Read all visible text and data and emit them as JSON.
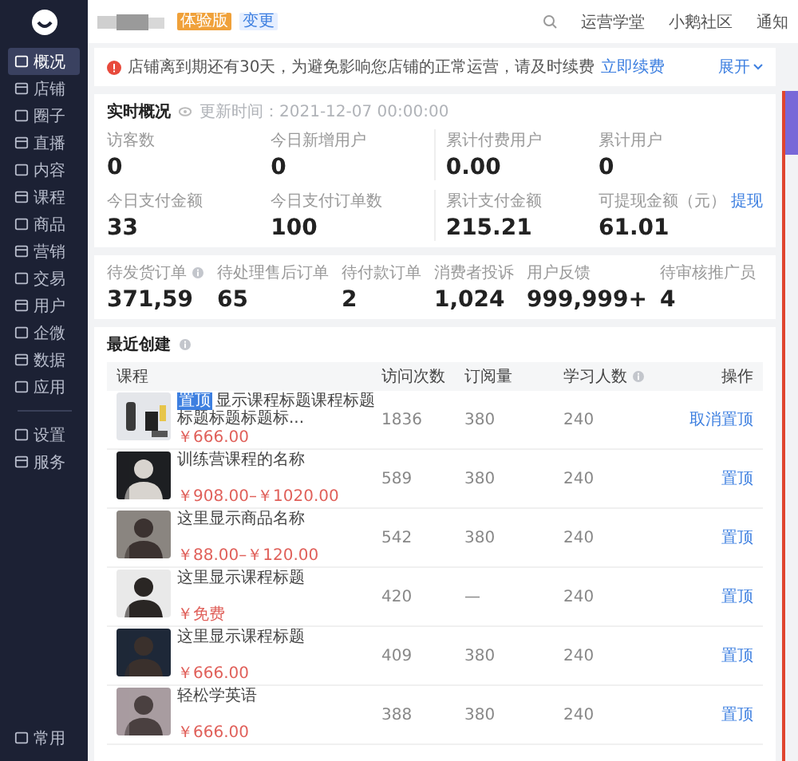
{
  "sidebar": {
    "items": [
      {
        "label": "概况",
        "selected": true
      },
      {
        "label": "店铺",
        "selected": false
      },
      {
        "label": "圈子",
        "selected": false
      },
      {
        "label": "直播",
        "selected": false
      },
      {
        "label": "内容",
        "selected": false
      },
      {
        "label": "课程",
        "selected": false
      },
      {
        "label": "商品",
        "selected": false
      },
      {
        "label": "营销",
        "selected": false
      },
      {
        "label": "交易",
        "selected": false
      },
      {
        "label": "用户",
        "selected": false
      },
      {
        "label": "企微",
        "selected": false
      },
      {
        "label": "数据",
        "selected": false
      },
      {
        "label": "应用",
        "selected": false
      }
    ],
    "settings_items": [
      {
        "label": "设置",
        "selected": false
      },
      {
        "label": "服务",
        "selected": false
      }
    ],
    "footer": "常用"
  },
  "header": {
    "badges": [
      {
        "text": "体验版",
        "kind": "edition"
      },
      {
        "text": "变更",
        "kind": "link"
      }
    ],
    "links": [
      "运营学堂",
      "小鹅社区",
      "通知"
    ]
  },
  "alert": {
    "message": "店铺离到期还有30天，为避免影响您店铺的正常运营，请及时续费",
    "action": "立即续费",
    "expand": "展开"
  },
  "realtime": {
    "title": "实时概况",
    "updated": "更新时间：2021-12-07 00:00:00",
    "metrics": [
      {
        "label": "访客数",
        "value": "0"
      },
      {
        "label": "今日新增用户",
        "value": "0"
      },
      {
        "label": "累计付费用户",
        "value": "0.00"
      },
      {
        "label": "累计用户",
        "value": "0"
      },
      {
        "label": "今日支付金额",
        "value": "33"
      },
      {
        "label": "今日支付订单数",
        "value": "100"
      },
      {
        "label": "累计支付金额",
        "value": "215.21"
      },
      {
        "label": "可提现金额（元）",
        "value": "61.01",
        "link": "提现"
      }
    ]
  },
  "todo": {
    "items": [
      {
        "label": "待发货订单",
        "value": "371,59",
        "info": true
      },
      {
        "label": "待处理售后订单",
        "value": "65",
        "info": false
      },
      {
        "label": "待付款订单",
        "value": "2",
        "info": false
      },
      {
        "label": "消费者投诉",
        "value": "1,024",
        "info": false
      },
      {
        "label": "用户反馈",
        "value": "999,999+",
        "info": false
      },
      {
        "label": "待审核推广员",
        "value": "4",
        "info": false
      }
    ]
  },
  "recent": {
    "title": "最近创建",
    "columns": [
      {
        "label": "课程",
        "info": false
      },
      {
        "label": "访问次数",
        "info": false
      },
      {
        "label": "订阅量",
        "info": false
      },
      {
        "label": "学习人数",
        "info": true
      },
      {
        "label": "操作",
        "info": false
      }
    ],
    "rows": [
      {
        "tag": "置顶",
        "title": "显示课程标题课程标题标题标题标题标...",
        "price": "￥666.00",
        "visits": "1836",
        "subs": "380",
        "learners": "240",
        "action": "取消置顶"
      },
      {
        "title": "训练营课程的名称",
        "price": "￥908.00–￥1020.00",
        "visits": "589",
        "subs": "380",
        "learners": "240",
        "action": "置顶"
      },
      {
        "title": "这里显示商品名称",
        "price": "￥88.00–￥120.00",
        "visits": "542",
        "subs": "380",
        "learners": "240",
        "action": "置顶"
      },
      {
        "title": "这里显示课程标题",
        "price": "￥免费",
        "visits": "420",
        "subs": "—",
        "learners": "240",
        "action": "置顶"
      },
      {
        "title": "这里显示课程标题",
        "price": "￥666.00",
        "visits": "409",
        "subs": "380",
        "learners": "240",
        "action": "置顶"
      },
      {
        "title": "轻松学英语",
        "price": "￥666.00",
        "visits": "388",
        "subs": "380",
        "learners": "240",
        "action": "置顶"
      }
    ]
  }
}
